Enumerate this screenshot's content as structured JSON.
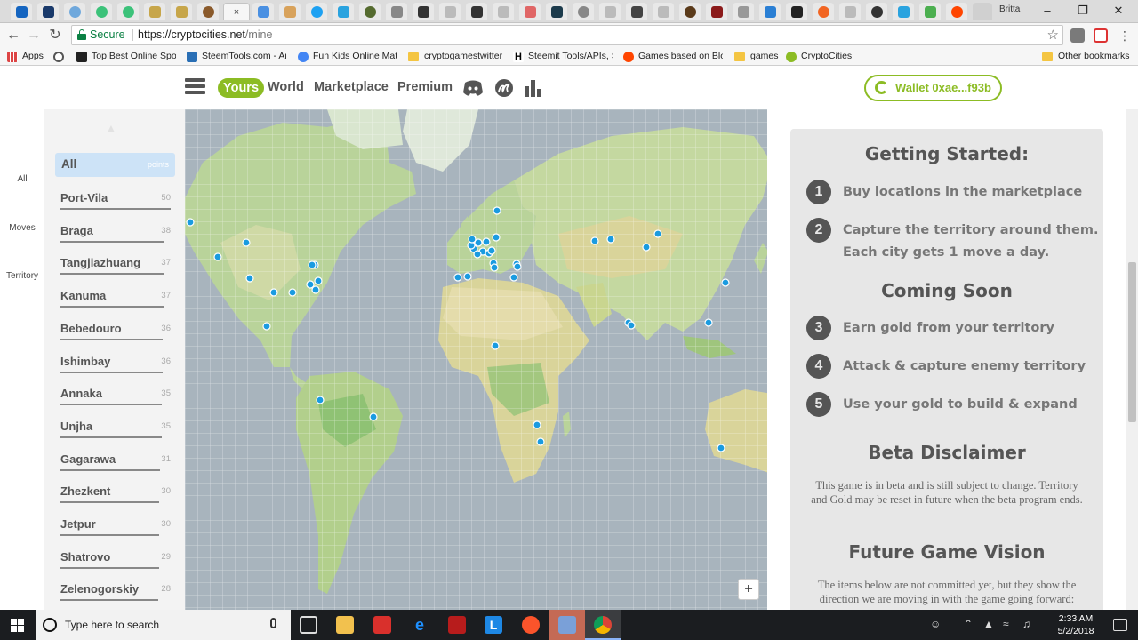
{
  "browser": {
    "user_name": "Britta",
    "active_tab_close": "×",
    "secure_label": "Secure",
    "url_base": "https://cryptocities.net",
    "url_path": "/mine",
    "bookmarks": [
      {
        "label": "Apps"
      },
      {
        "label": ""
      },
      {
        "label": "Top Best Online Spor"
      },
      {
        "label": "SteemTools.com - An"
      },
      {
        "label": "Fun Kids Online Math"
      },
      {
        "label": "cryptogamestwitter"
      },
      {
        "label": "Steemit Tools/APIs, St"
      },
      {
        "label": "Games based on Bloc"
      },
      {
        "label": "games"
      },
      {
        "label": "CryptoCities"
      },
      {
        "label": "Other bookmarks"
      }
    ]
  },
  "nav": {
    "yours": "Yours",
    "world": "World",
    "marketplace": "Marketplace",
    "premium": "Premium",
    "wallet": "Wallet 0xae...f93b"
  },
  "sidebar_tabs": {
    "all": "All",
    "moves": "Moves",
    "territory": "Territory"
  },
  "city_list": {
    "header_label": "All",
    "header_points": "points",
    "cities": [
      {
        "name": "Port-Vila",
        "points": "50"
      },
      {
        "name": "Braga",
        "points": "38"
      },
      {
        "name": "Tangjiazhuang",
        "points": "37"
      },
      {
        "name": "Kanuma",
        "points": "37"
      },
      {
        "name": "Bebedouro",
        "points": "36"
      },
      {
        "name": "Ishimbay",
        "points": "36"
      },
      {
        "name": "Annaka",
        "points": "35"
      },
      {
        "name": "Unjha",
        "points": "35"
      },
      {
        "name": "Gagarawa",
        "points": "31"
      },
      {
        "name": "Zhezkent",
        "points": "30"
      },
      {
        "name": "Jetpur",
        "points": "30"
      },
      {
        "name": "Shatrovo",
        "points": "29"
      },
      {
        "name": "Zelenogorskiy",
        "points": "28"
      }
    ]
  },
  "map": {
    "zoom_in": "+",
    "city_marker_color": "#1a9be0"
  },
  "info": {
    "getting_started_title": "Getting Started:",
    "steps_now": [
      {
        "num": "1",
        "text": "Buy locations in the marketplace"
      },
      {
        "num": "2",
        "text": "Capture the territory around them. Each city gets 1 move a day."
      }
    ],
    "coming_soon_title": "Coming Soon",
    "steps_soon": [
      {
        "num": "3",
        "text": "Earn gold from your territory"
      },
      {
        "num": "4",
        "text": "Attack & capture enemy territory"
      },
      {
        "num": "5",
        "text": "Use your gold to build & expand"
      }
    ],
    "beta_title": "Beta Disclaimer",
    "beta_text": "This game is in beta and is still subject to change. Territory and Gold may be reset in future when the beta program ends.",
    "vision_title": "Future Game Vision",
    "vision_text": "The items below are not committed yet, but they show the direction we are moving in with the game going forward:"
  },
  "taskbar": {
    "search_placeholder": "Type here to search",
    "time": "2:33 AM",
    "date": "5/2/2018"
  },
  "colors": {
    "brand_green": "#8cbc24",
    "marker_blue": "#1a9be0",
    "ocean": "#a8b4bd",
    "land": "#b9d39a"
  }
}
